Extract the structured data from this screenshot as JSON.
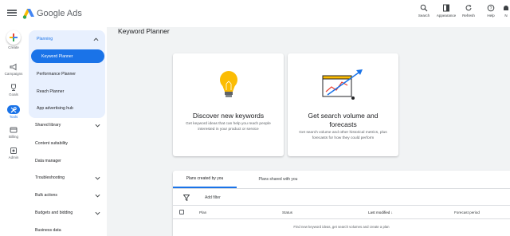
{
  "header": {
    "brand": "Google Ads",
    "actions": [
      {
        "label": "Search",
        "icon": "search-icon"
      },
      {
        "label": "Appearance",
        "icon": "appearance-icon"
      },
      {
        "label": "Refresh",
        "icon": "refresh-icon"
      },
      {
        "label": "Help",
        "icon": "help-icon"
      },
      {
        "label": "N",
        "icon": "notifications-icon"
      }
    ]
  },
  "rail": {
    "items": [
      {
        "label": "Create",
        "icon": "plus-icon"
      },
      {
        "label": "Campaigns",
        "icon": "megaphone-icon"
      },
      {
        "label": "Goals",
        "icon": "trophy-icon"
      },
      {
        "label": "Tools",
        "icon": "tools-icon"
      },
      {
        "label": "Billing",
        "icon": "credit-card-icon"
      },
      {
        "label": "Admin",
        "icon": "admin-gear-icon"
      }
    ]
  },
  "nav": {
    "planning_label": "Planning",
    "sub_items": [
      {
        "label": "Keyword Planner",
        "active": true
      },
      {
        "label": "Performance Planner",
        "active": false
      },
      {
        "label": "Reach Planner",
        "active": false
      },
      {
        "label": "App advertising hub",
        "active": false
      }
    ],
    "items": [
      {
        "label": "Shared library",
        "expandable": true
      },
      {
        "label": "Content suitability",
        "expandable": false
      },
      {
        "label": "Data manager",
        "expandable": false
      },
      {
        "label": "Troubleshooting",
        "expandable": true
      },
      {
        "label": "Bulk actions",
        "expandable": true
      },
      {
        "label": "Budgets and bidding",
        "expandable": true
      },
      {
        "label": "Business data",
        "expandable": false
      }
    ]
  },
  "page": {
    "title": "Keyword Planner"
  },
  "cards": {
    "discover": {
      "title": "Discover new keywords",
      "description": "Get keyword ideas that can help you reach people interested in your product or service",
      "icon": "lightbulb-icon"
    },
    "volume": {
      "title_line1": "Get search volume and",
      "title_line2": "forecasts",
      "description": "Get search volume and other historical metrics, plus forecasts for how they could perform",
      "icon": "trend-chart-icon"
    }
  },
  "plans": {
    "tabs": [
      {
        "label": "Plans created by you",
        "active": true
      },
      {
        "label": "Plans shared with you",
        "active": false
      }
    ],
    "filter_label": "Add filter",
    "columns": [
      "Plan",
      "Status",
      "Last modified",
      "Forecast period"
    ],
    "empty_text": "Find new keyword ideas, get search volumes and create a plan"
  },
  "colors": {
    "accent": "#1a73e8",
    "nav_highlight": "#e8f0fe",
    "background": "#f1f3f4",
    "bulb": "#fbbc04"
  }
}
